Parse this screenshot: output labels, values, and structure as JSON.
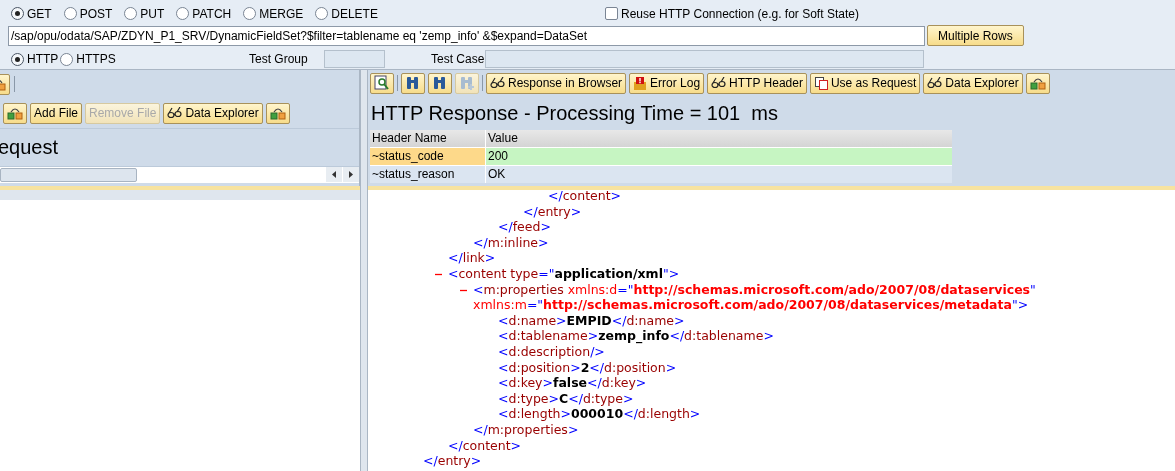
{
  "methods": [
    {
      "label": "GET",
      "selected": true
    },
    {
      "label": "POST",
      "selected": false
    },
    {
      "label": "PUT",
      "selected": false
    },
    {
      "label": "PATCH",
      "selected": false
    },
    {
      "label": "MERGE",
      "selected": false
    },
    {
      "label": "DELETE",
      "selected": false
    }
  ],
  "reuse_connection": {
    "label": "Reuse HTTP Connection (e.g. for Soft State)",
    "checked": false
  },
  "url": "/sap/opu/odata/SAP/ZDYN_P1_SRV/DynamicFieldSet?$filter=tablename eq 'zemp_info' &$expand=DataSet",
  "multiple_rows_button": "Multiple Rows",
  "protocols": [
    {
      "label": "HTTP",
      "selected": true
    },
    {
      "label": "HTTPS",
      "selected": false
    }
  ],
  "test_group": {
    "label": "Test Group"
  },
  "test_case": {
    "label": "Test Case"
  },
  "request": {
    "title": "equest",
    "buttons": [
      {
        "label": "Add File",
        "disabled": false
      },
      {
        "label": "Remove File",
        "disabled": true
      },
      {
        "label": "Data Explorer",
        "disabled": false
      }
    ]
  },
  "response": {
    "title": "HTTP Response - Processing Time = 101  ms",
    "icon_buttons": [
      {
        "disabled": false
      },
      {
        "disabled": false
      },
      {
        "disabled": true
      }
    ],
    "buttons": [
      {
        "label": "Response in Browser",
        "disabled": false
      },
      {
        "label": "Error Log",
        "disabled": false
      },
      {
        "label": "HTTP Header",
        "disabled": false
      },
      {
        "label": "Use as Request",
        "disabled": false
      },
      {
        "label": "Data Explorer",
        "disabled": false
      }
    ],
    "table": {
      "columns": [
        "Header Name",
        "Value"
      ],
      "rows": [
        {
          "name": "~status_code",
          "value": "200",
          "selected": true
        },
        {
          "name": "~status_reason",
          "value": "OK",
          "selected": false
        }
      ]
    }
  },
  "xml": [
    {
      "children": [
        {
          "children": [
            {
              "children": [
                {
                  "children": [
                    {
                      "children": [
                        {
                          "tokens": [
                            {
                              "kind": "punct",
                              "t": "</"
                            },
                            {
                              "kind": "name",
                              "t": "content"
                            },
                            {
                              "kind": "punct",
                              "t": ">"
                            }
                          ]
                        }
                      ]
                    },
                    {
                      "tokens": [
                        {
                          "kind": "punct",
                          "t": "</"
                        },
                        {
                          "kind": "name",
                          "t": "entry"
                        },
                        {
                          "kind": "punct",
                          "t": ">"
                        }
                      ]
                    }
                  ]
                },
                {
                  "tokens": [
                    {
                      "kind": "punct",
                      "t": "</"
                    },
                    {
                      "kind": "name",
                      "t": "feed"
                    },
                    {
                      "kind": "punct",
                      "t": ">"
                    }
                  ]
                }
              ]
            },
            {
              "tokens": [
                {
                  "kind": "punct",
                  "t": "</"
                },
                {
                  "kind": "name",
                  "t": "m:inline"
                },
                {
                  "kind": "punct",
                  "t": ">"
                }
              ]
            }
          ]
        },
        {
          "tokens": [
            {
              "kind": "punct",
              "t": "</"
            },
            {
              "kind": "name",
              "t": "link"
            },
            {
              "kind": "punct",
              "t": ">"
            }
          ]
        },
        {
          "expanded": true,
          "tokens": [
            {
              "kind": "punct",
              "t": "<"
            },
            {
              "kind": "name",
              "t": "content type"
            },
            {
              "kind": "punct",
              "t": "=\""
            },
            {
              "kind": "text",
              "t": "application/xml"
            },
            {
              "kind": "punct",
              "t": "\">"
            }
          ],
          "children": [
            {
              "expanded": true,
              "tokens": [
                {
                  "kind": "punct",
                  "t": "<"
                },
                {
                  "kind": "name",
                  "t": "m:properties "
                },
                {
                  "kind": "attr",
                  "t": "xmlns:d"
                },
                {
                  "kind": "punct",
                  "t": "=\""
                },
                {
                  "kind": "value",
                  "t": "http://schemas.microsoft.com/ado/2007/08/dataservices"
                },
                {
                  "kind": "punct",
                  "t": "\""
                },
                {
                  "kind": "break"
                },
                {
                  "kind": "attr",
                  "t": "xmlns:m"
                },
                {
                  "kind": "punct",
                  "t": "=\""
                },
                {
                  "kind": "value",
                  "t": "http://schemas.microsoft.com/ado/2007/08/dataservices/metadata"
                },
                {
                  "kind": "punct",
                  "t": "\">"
                }
              ],
              "children": [
                {
                  "tokens": [
                    {
                      "kind": "punct",
                      "t": "<"
                    },
                    {
                      "kind": "name",
                      "t": "d:name"
                    },
                    {
                      "kind": "punct",
                      "t": ">"
                    },
                    {
                      "kind": "text",
                      "t": "EMPID"
                    },
                    {
                      "kind": "punct",
                      "t": "</"
                    },
                    {
                      "kind": "name",
                      "t": "d:name"
                    },
                    {
                      "kind": "punct",
                      "t": ">"
                    }
                  ]
                },
                {
                  "tokens": [
                    {
                      "kind": "punct",
                      "t": "<"
                    },
                    {
                      "kind": "name",
                      "t": "d:tablename"
                    },
                    {
                      "kind": "punct",
                      "t": ">"
                    },
                    {
                      "kind": "text",
                      "t": "zemp_info"
                    },
                    {
                      "kind": "punct",
                      "t": "</"
                    },
                    {
                      "kind": "name",
                      "t": "d:tablename"
                    },
                    {
                      "kind": "punct",
                      "t": ">"
                    }
                  ]
                },
                {
                  "tokens": [
                    {
                      "kind": "punct",
                      "t": "<"
                    },
                    {
                      "kind": "name",
                      "t": "d:description"
                    },
                    {
                      "kind": "punct",
                      "t": "/>"
                    }
                  ]
                },
                {
                  "tokens": [
                    {
                      "kind": "punct",
                      "t": "<"
                    },
                    {
                      "kind": "name",
                      "t": "d:position"
                    },
                    {
                      "kind": "punct",
                      "t": ">"
                    },
                    {
                      "kind": "text",
                      "t": "2"
                    },
                    {
                      "kind": "punct",
                      "t": "</"
                    },
                    {
                      "kind": "name",
                      "t": "d:position"
                    },
                    {
                      "kind": "punct",
                      "t": ">"
                    }
                  ]
                },
                {
                  "tokens": [
                    {
                      "kind": "punct",
                      "t": "<"
                    },
                    {
                      "kind": "name",
                      "t": "d:key"
                    },
                    {
                      "kind": "punct",
                      "t": ">"
                    },
                    {
                      "kind": "text",
                      "t": "false"
                    },
                    {
                      "kind": "punct",
                      "t": "</"
                    },
                    {
                      "kind": "name",
                      "t": "d:key"
                    },
                    {
                      "kind": "punct",
                      "t": ">"
                    }
                  ]
                },
                {
                  "tokens": [
                    {
                      "kind": "punct",
                      "t": "<"
                    },
                    {
                      "kind": "name",
                      "t": "d:type"
                    },
                    {
                      "kind": "punct",
                      "t": ">"
                    },
                    {
                      "kind": "text",
                      "t": "C"
                    },
                    {
                      "kind": "punct",
                      "t": "</"
                    },
                    {
                      "kind": "name",
                      "t": "d:type"
                    },
                    {
                      "kind": "punct",
                      "t": ">"
                    }
                  ]
                },
                {
                  "tokens": [
                    {
                      "kind": "punct",
                      "t": "<"
                    },
                    {
                      "kind": "name",
                      "t": "d:length"
                    },
                    {
                      "kind": "punct",
                      "t": ">"
                    },
                    {
                      "kind": "text",
                      "t": "000010"
                    },
                    {
                      "kind": "punct",
                      "t": "</"
                    },
                    {
                      "kind": "name",
                      "t": "d:length"
                    },
                    {
                      "kind": "punct",
                      "t": ">"
                    }
                  ]
                }
              ]
            },
            {
              "tokens": [
                {
                  "kind": "punct",
                  "t": "</"
                },
                {
                  "kind": "name",
                  "t": "m:properties"
                },
                {
                  "kind": "punct",
                  "t": ">"
                }
              ]
            }
          ]
        },
        {
          "tokens": [
            {
              "kind": "punct",
              "t": "</"
            },
            {
              "kind": "name",
              "t": "content"
            },
            {
              "kind": "punct",
              "t": ">"
            }
          ]
        }
      ]
    },
    {
      "tokens": [
        {
          "kind": "punct",
          "t": "</"
        },
        {
          "kind": "name",
          "t": "entry"
        },
        {
          "kind": "punct",
          "t": ">"
        }
      ]
    }
  ]
}
